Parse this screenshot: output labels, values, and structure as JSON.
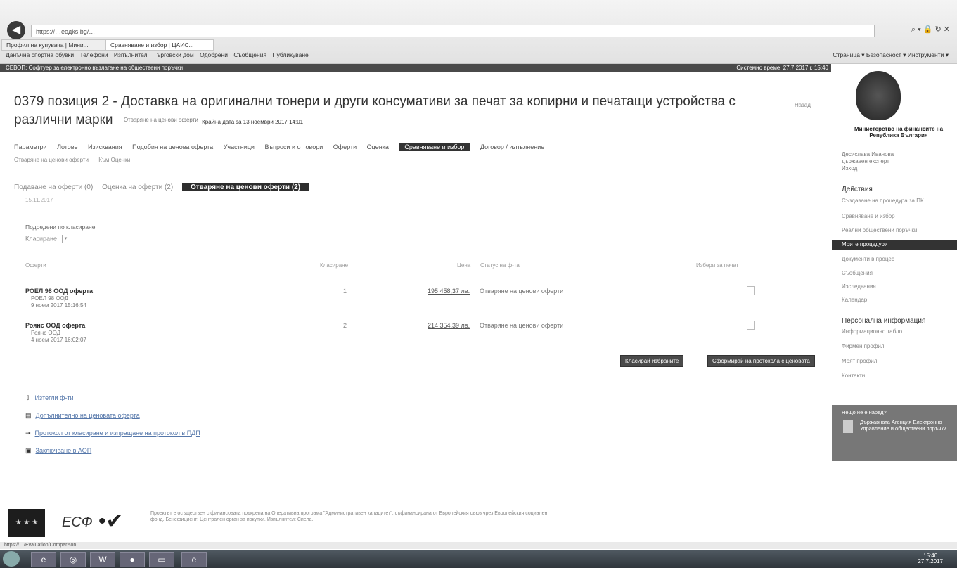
{
  "browser": {
    "url": "https://…eoдks.bg/…",
    "tabs": [
      "Профил на купувача | Мини...",
      "Сравняване и избор | ЦАИС..."
    ],
    "favorites": [
      "Данъчна спортна обувки",
      "Телефони",
      "Изпълнител",
      "Търговски дом",
      "Одобрени",
      "Съобщения",
      "Публикуване"
    ],
    "right_tools": "Страница ▾  Безопасност ▾  Инструменти ▾"
  },
  "sitebar": {
    "left": "СЕВОП: Софтуер за електронно възлагане на обществени поръчки",
    "right": "Системно време: 27.7.2017 г. 15:40"
  },
  "header": {
    "title": "0379 позиция 2 - Доставка на оригинални тонери и други консумативи за печат за копирни и печатащи устройства с различни марки",
    "status": "Отваряне на ценови оферти",
    "date": "Крайна дата за 13 ноември 2017 14:01",
    "side_link": "Назад"
  },
  "navtabs": [
    "Параметри",
    "Лотове",
    "Изисквания",
    "Подобия на ценова оферта",
    "Участници",
    "Въпроси и отговори",
    "Оферти",
    "Оценка",
    "Сравняване и избор",
    "Договор / изпълнение"
  ],
  "subnav": [
    "Отваряне на ценови оферти",
    "Към Оценки"
  ],
  "steps": [
    "Подаване на оферти (0)",
    "Оценка на оферти (2)",
    "Отваряне на ценови оферти (2)"
  ],
  "steps_sub": "15.11.2017",
  "filter": {
    "label": "Подредени по класиране",
    "value": "Класиране"
  },
  "table": {
    "headers": [
      "Оферти",
      "Класиране",
      "Цена",
      "Статус на ф-та",
      "Избери за печат"
    ],
    "rows": [
      {
        "name": "РОЕЛ 98 ООД оферта",
        "org": "РОЕЛ 98 ООД",
        "date": "9 ноем 2017 15:16:54",
        "count": "1",
        "price": "195 458,37 лв.",
        "status": "Отваряне на ценови оферти"
      },
      {
        "name": "Роянс ООД оферта",
        "org": "Роянс ООД",
        "date": "4 ноем 2017 16:02:07",
        "count": "2",
        "price": "214 354,39 лв.",
        "status": "Отваряне на ценови оферти"
      }
    ]
  },
  "buttons": {
    "primary": "Класирай избраните",
    "secondary": "Сформирай на протокола с ценоватa"
  },
  "links": [
    "Изтегли ф-ти",
    "Допълнително на ценовата оферта",
    "Протокол от класиране и изпращане на протокол в ПДП",
    "Заключване в АОП"
  ],
  "sidebar": {
    "ministry": "Министерство на финансите на Република България",
    "user": [
      "Десислава Иванова",
      "държавен експерт",
      "Изход"
    ],
    "h_actions": "Действия",
    "actions": [
      "Създаване на процедура за ПК",
      "Сравняване и избор",
      "Реални обществени поръчки",
      "Моите процедури",
      "Документи в процес",
      "Съобщения",
      "Изследвания",
      "Календар"
    ],
    "active_index": 3,
    "h_personal": "Персонална информация",
    "personal": [
      "Информационно табло",
      "Фирмен профил",
      "Моят профил",
      "Контакти"
    ],
    "question_title": "Нещо не е наред?",
    "question_text": "Държавната Агенция Електронно Управление и обществени поръчки"
  },
  "footer": {
    "eu": "ЕС",
    "esf": "ЕСФ",
    "text": "Проектът е осъществен с финансовата подкрепа на Оперативна програма \"Административен капацитет\", съфинансирана от Европейския съюз чрез Европейския социален фонд. Бенефициент: Централен орган за покупки. Изпълнител: Сиела."
  },
  "statusbar": "https://…/Evaluation/Comparison…",
  "taskbar": {
    "time": "15:40",
    "date": "27.7.2017"
  }
}
